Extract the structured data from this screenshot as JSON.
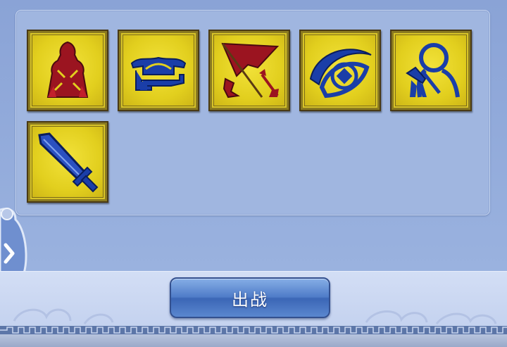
{
  "skills": [
    {
      "name": "hooded-figure-icon"
    },
    {
      "name": "bridge-boat-icon"
    },
    {
      "name": "war-banner-spear-icon"
    },
    {
      "name": "eye-icon"
    },
    {
      "name": "warrior-portrait-icon"
    },
    {
      "name": "sword-icon"
    }
  ],
  "side_tab": {
    "icon": "chevron-right-icon"
  },
  "bottom": {
    "fight_label": "出战"
  },
  "colors": {
    "accent": "#1a3ea8",
    "crimson": "#9b1420",
    "gold": "#e6d22a"
  }
}
